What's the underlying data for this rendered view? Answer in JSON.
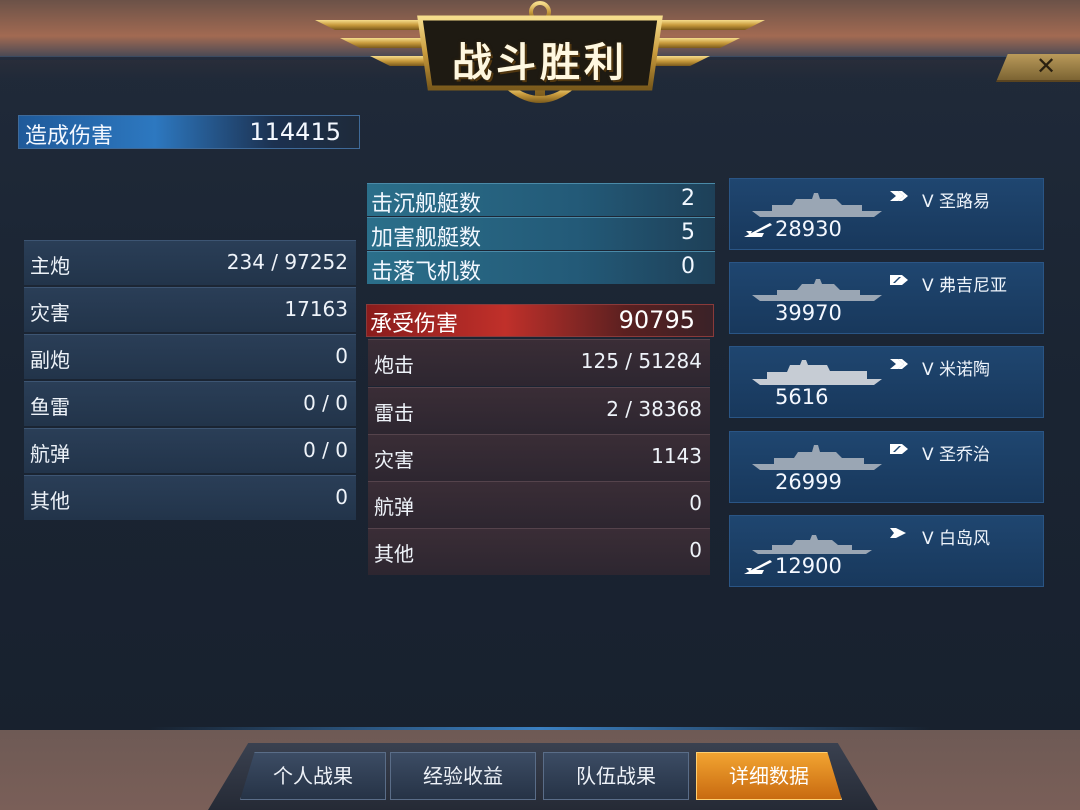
{
  "title": "战斗胜利",
  "close_label": "✕",
  "damage_dealt": {
    "label": "造成伤害",
    "value": "114415"
  },
  "dealt_breakdown": [
    {
      "label": "主炮",
      "value": "234 / 97252"
    },
    {
      "label": "灾害",
      "value": "17163"
    },
    {
      "label": "副炮",
      "value": "0"
    },
    {
      "label": "鱼雷",
      "value": "0 / 0"
    },
    {
      "label": "航弹",
      "value": "0 / 0"
    },
    {
      "label": "其他",
      "value": "0"
    }
  ],
  "kills": [
    {
      "label": "击沉舰艇数",
      "value": "2"
    },
    {
      "label": "加害舰艇数",
      "value": "5"
    },
    {
      "label": "击落飞机数",
      "value": "0"
    }
  ],
  "damage_received": {
    "label": "承受伤害",
    "value": "90795"
  },
  "received_breakdown": [
    {
      "label": "炮击",
      "value": "125 / 51284"
    },
    {
      "label": "雷击",
      "value": "2 / 38368"
    },
    {
      "label": "灾害",
      "value": "1143"
    },
    {
      "label": "航弹",
      "value": "0"
    },
    {
      "label": "其他",
      "value": "0"
    }
  ],
  "ships": [
    {
      "name": "V 圣路易",
      "damage": "28930",
      "rank_icon": "double-chevron-icon",
      "has_plane": true
    },
    {
      "name": "V 弗吉尼亚",
      "damage": "39970",
      "rank_icon": "stripe-chevron-icon",
      "has_plane": false
    },
    {
      "name": "V 米诺陶",
      "damage": "5616",
      "rank_icon": "double-chevron-icon",
      "has_plane": false
    },
    {
      "name": "V 圣乔治",
      "damage": "26999",
      "rank_icon": "stripe-chevron-icon",
      "has_plane": false
    },
    {
      "name": "V 白岛风",
      "damage": "12900",
      "rank_icon": "single-chevron-icon",
      "has_plane": true
    }
  ],
  "tabs": [
    {
      "label": "个人战果",
      "active": false
    },
    {
      "label": "经验收益",
      "active": false
    },
    {
      "label": "队伍战果",
      "active": false
    },
    {
      "label": "详细数据",
      "active": true
    }
  ],
  "colors": {
    "dealt_accent": "#2d78c0",
    "received_accent": "#c0302a",
    "kills_accent": "#2b6f8a",
    "active_tab": "#f2a431"
  }
}
